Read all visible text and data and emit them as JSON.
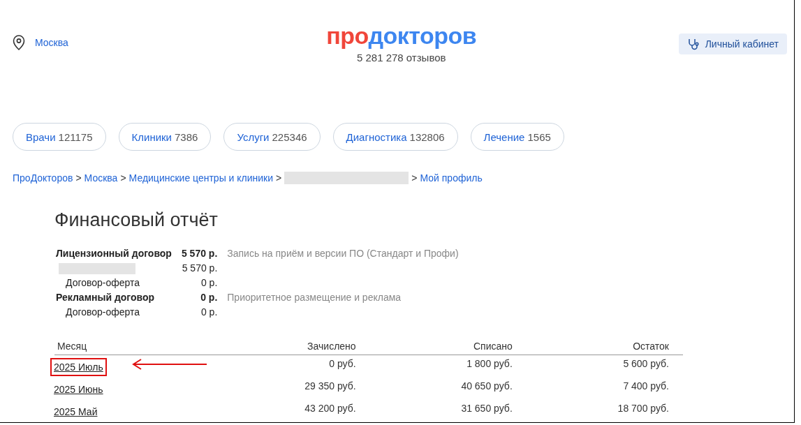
{
  "header": {
    "location": "Москва",
    "logo_first": "про",
    "logo_second": "докторов",
    "reviews": "5 281 278 отзывов",
    "account_button": "Личный кабинет"
  },
  "categories": [
    {
      "label": "Врачи",
      "count": "121175"
    },
    {
      "label": "Клиники",
      "count": "7386"
    },
    {
      "label": "Услуги",
      "count": "225346"
    },
    {
      "label": "Диагностика",
      "count": "132806"
    },
    {
      "label": "Лечение",
      "count": "1565"
    }
  ],
  "breadcrumb_separator": ">",
  "breadcrumbs": [
    {
      "kind": "link",
      "text": "ПроДокторов"
    },
    {
      "kind": "link",
      "text": "Москва"
    },
    {
      "kind": "link",
      "text": "Медицинские центры и клиники"
    },
    {
      "kind": "redacted"
    },
    {
      "kind": "link",
      "text": "Мой профиль"
    }
  ],
  "report": {
    "title": "Финансовый отчёт",
    "contracts": [
      {
        "kind": "main",
        "name": "Лицензионный договор",
        "amount": "5 570 р.",
        "note": "Запись на приём и версии ПО (Стандарт и Профи)"
      },
      {
        "kind": "redacted",
        "amount": "5 570 р."
      },
      {
        "kind": "sub",
        "name": "Договор-оферта",
        "amount": "0 р."
      },
      {
        "kind": "main",
        "name": "Рекламный договор",
        "amount": "0 р.",
        "note": "Приоритетное размещение и реклама"
      },
      {
        "kind": "sub",
        "name": "Договор-оферта",
        "amount": "0 р."
      }
    ],
    "columns": [
      "Месяц",
      "Зачислено",
      "Списано",
      "Остаток"
    ],
    "rows": [
      {
        "month": "2025 Июль",
        "credited": "0 руб.",
        "debited": "1 800 руб.",
        "balance": "5 600 руб.",
        "highlighted": true
      },
      {
        "month": "2025 Июнь",
        "credited": "29 350 руб.",
        "debited": "40 650 руб.",
        "balance": "7 400 руб.",
        "highlighted": false
      },
      {
        "month": "2025 Май",
        "credited": "43 200 руб.",
        "debited": "31 650 руб.",
        "balance": "18 700 руб.",
        "highlighted": false
      }
    ]
  }
}
